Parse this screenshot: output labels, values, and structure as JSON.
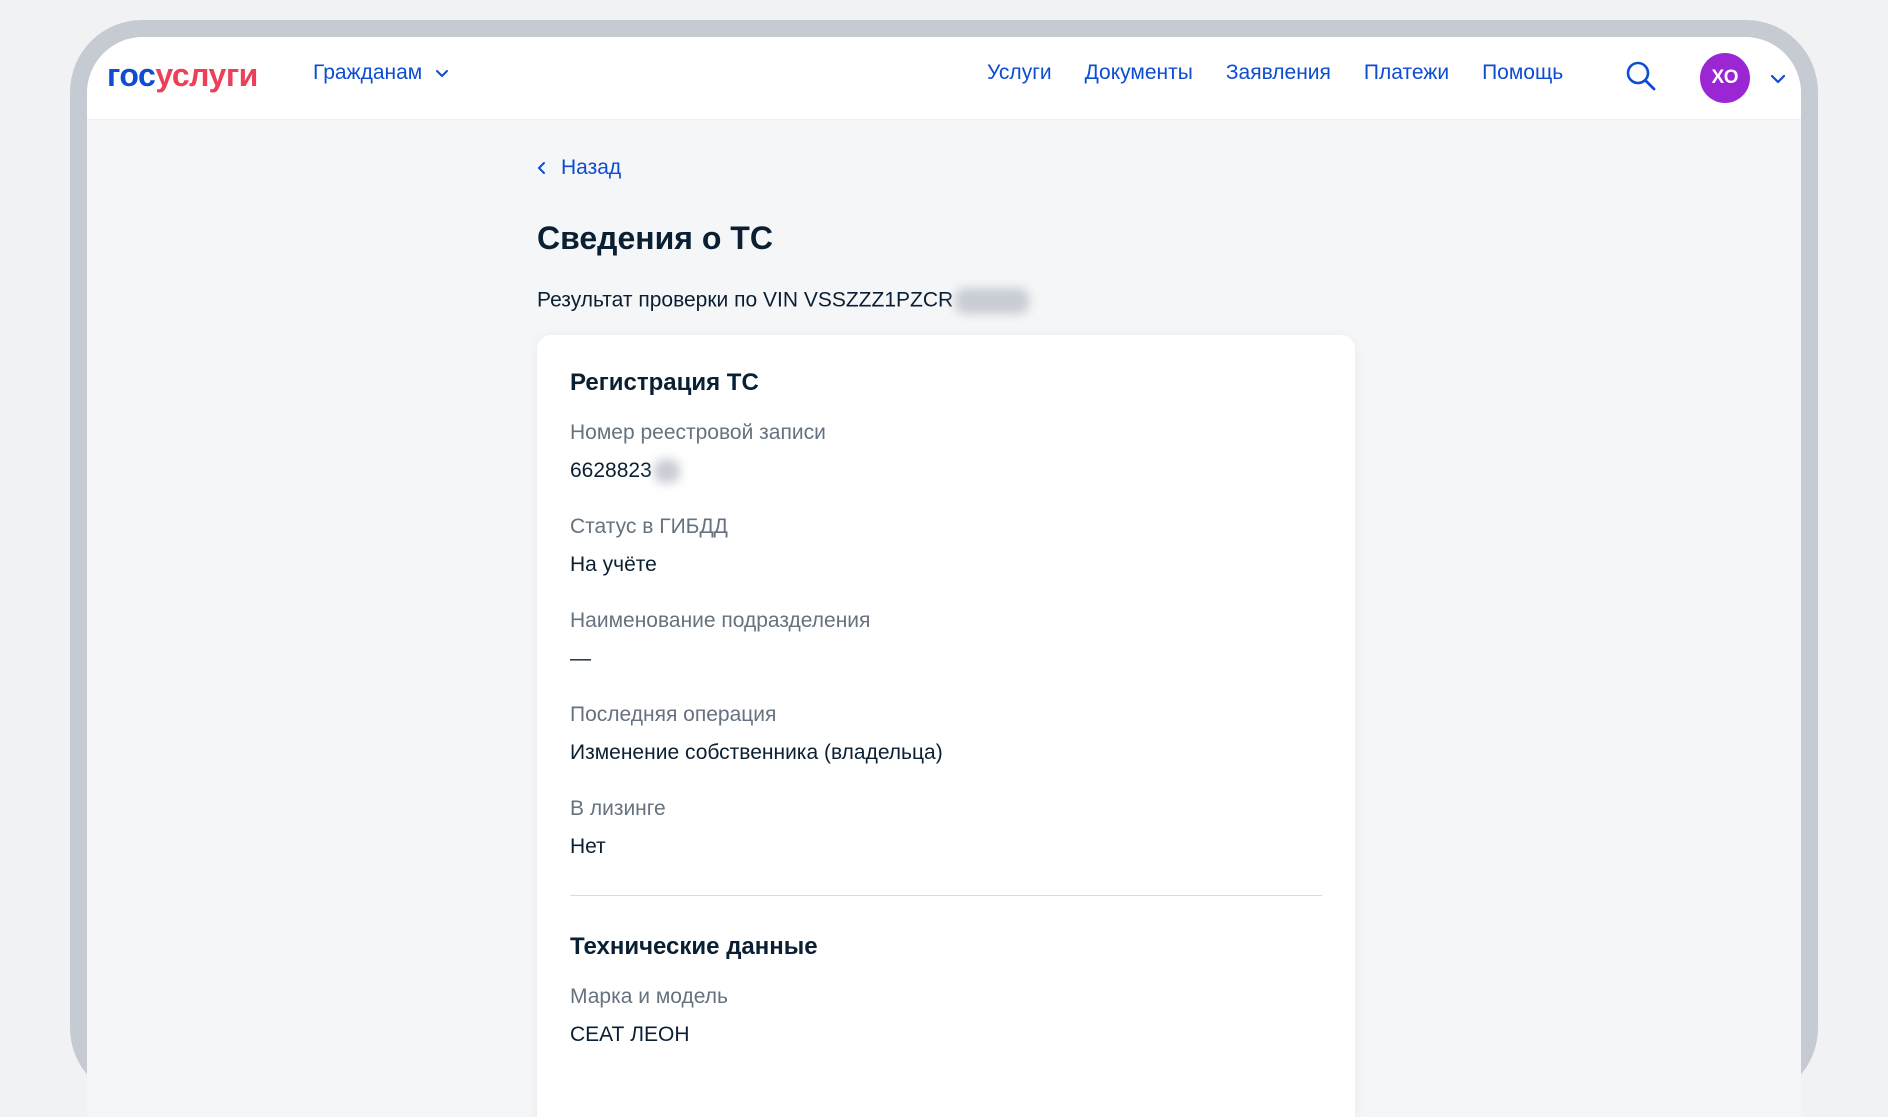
{
  "header": {
    "logo_part1": "гос",
    "logo_part2": "услуги",
    "audience_label": "Гражданам",
    "nav": [
      "Услуги",
      "Документы",
      "Заявления",
      "Платежи",
      "Помощь"
    ],
    "avatar_initials": "ХО"
  },
  "page": {
    "back_label": "Назад",
    "title": "Сведения о ТС",
    "vin_text": "Результат проверки по VIN VSSZZZ1PZCR"
  },
  "registration": {
    "title": "Регистрация ТС",
    "registry_label": "Номер реестровой записи",
    "registry_value": "6628823",
    "status_label": "Статус в ГИБДД",
    "status_value": "На учёте",
    "division_label": "Наименование подразделения",
    "division_value": "—",
    "operation_label": "Последняя операция",
    "operation_value": "Изменение собственника (владельца)",
    "leasing_label": "В лизинге",
    "leasing_value": "Нет"
  },
  "technical": {
    "title": "Технические данные",
    "model_label": "Марка и модель",
    "model_value": "СЕАТ ЛЕОН"
  },
  "colors": {
    "brand_blue": "#0d4cd3",
    "brand_red": "#ee3f58",
    "avatar_purple": "#9b27d4",
    "text_dark": "#0b1f33",
    "text_muted": "#66727f"
  },
  "icons": [
    "chevron-down-icon",
    "search-icon",
    "chevron-left-icon"
  ]
}
